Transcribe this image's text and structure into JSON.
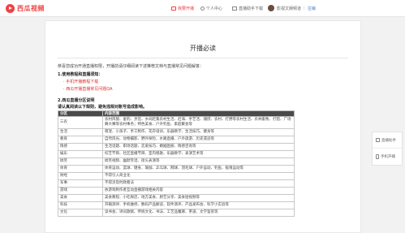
{
  "header": {
    "logo_text": "西瓜视频",
    "nav_live": "我要开播",
    "nav_center": "个人中心",
    "nav_download": "直播助手下载",
    "user_name": "影视文娱频道",
    "logout": "注销",
    "brand_color": "#f04142"
  },
  "doc": {
    "title": "开播必读",
    "intro": "恭喜您成功开通直播权限，开播前请仔细阅读下述推荐文档与直播常见问题解答：",
    "section1_title": "1.使用教程和直播须知：",
    "link1": "手机开播教程下载",
    "link2": "西瓜开播直播常见问题QA",
    "section2_title": "2.西瓜直播分区说明",
    "section2_sub": "请认真阅读以下规则，避免违规对账号造成影响。",
    "table_headers": [
      "分区",
      "内容范围"
    ],
    "table_rows": [
      {
        "cat": "三农",
        "desc": "农村风貌、垂钓、烹饪、乡间赶集农村生活、赶海、手艺活、捕捞、农村、打野等农村生活、农林畜牧、打猎、广场舞大赛等农村事务；特色美食、户外钓鱼、家庭聚会等"
      },
      {
        "cat": "生活",
        "desc": "萌宠、小孩子、手工制作、花卉培训、乐器教学、生活技巧、健身等"
      },
      {
        "cat": "教育",
        "desc": "自然风光、动物摄影、野外探险、水路直播、户外旅游、历史遗迹等"
      },
      {
        "cat": "情感",
        "desc": "生活话题、职场话题、恋爱技巧、婚姻困惑、情感咨询等"
      },
      {
        "cat": "娱乐",
        "desc": "综艺节目、社区直播节目、室内唱歌、乐器教学、表演艺术等"
      },
      {
        "cat": "搞笑",
        "desc": "搞笑视频、幽默笑话、街头表演等"
      },
      {
        "cat": "体育",
        "desc": "体育运动、篮球、健身、瑜伽、乒乓球、网球、羽毛球、户外运动、钓鱼、极限运动等"
      },
      {
        "cat": "财经",
        "desc": "不得引入商业化"
      },
      {
        "cat": "军事",
        "desc": "不得涉及时政看法"
      },
      {
        "cat": "游戏",
        "desc": "依游戏制作者互动直播游戏相关内容"
      },
      {
        "cat": "美食",
        "desc": "美食教程、小吃探店、地方美食、厨艺分享、美食短视频等"
      },
      {
        "cat": "科技",
        "desc": "开箱测评、手机维修、数码产品解读、软件测评、产品发布会、科学小实验等"
      },
      {
        "cat": "文化",
        "desc": "读书会、诗词歌赋、传统文化、书法、工艺品雕琢、茶道、文学鉴赏等"
      }
    ]
  },
  "float": {
    "item1": "直播助手",
    "item2": "手机开播"
  }
}
